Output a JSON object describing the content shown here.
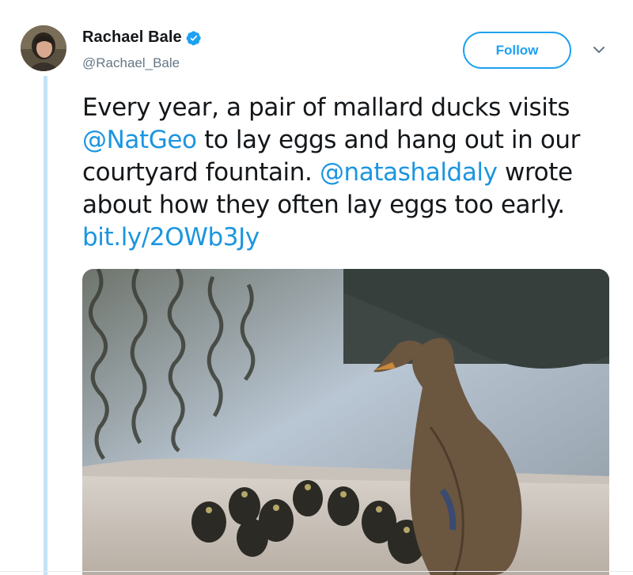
{
  "author": {
    "display_name": "Rachael Bale",
    "handle": "@Rachael_Bale",
    "verified": true
  },
  "actions": {
    "follow_label": "Follow",
    "menu_icon": "chevron-down-icon"
  },
  "tweet": {
    "parts": [
      "Every year, a pair of mallard ducks visits ",
      "@NatGeo",
      " to lay eggs and hang out in our courtyard fountain. ",
      "@natashaldaly",
      " wrote about how they often lay eggs too early. ",
      "bit.ly/2OWb3Jy"
    ]
  },
  "colors": {
    "accent": "#1da1f2",
    "link": "#1b95e0",
    "text": "#14171a",
    "secondary_text": "#657786",
    "thread_line": "#c4e3f7"
  }
}
